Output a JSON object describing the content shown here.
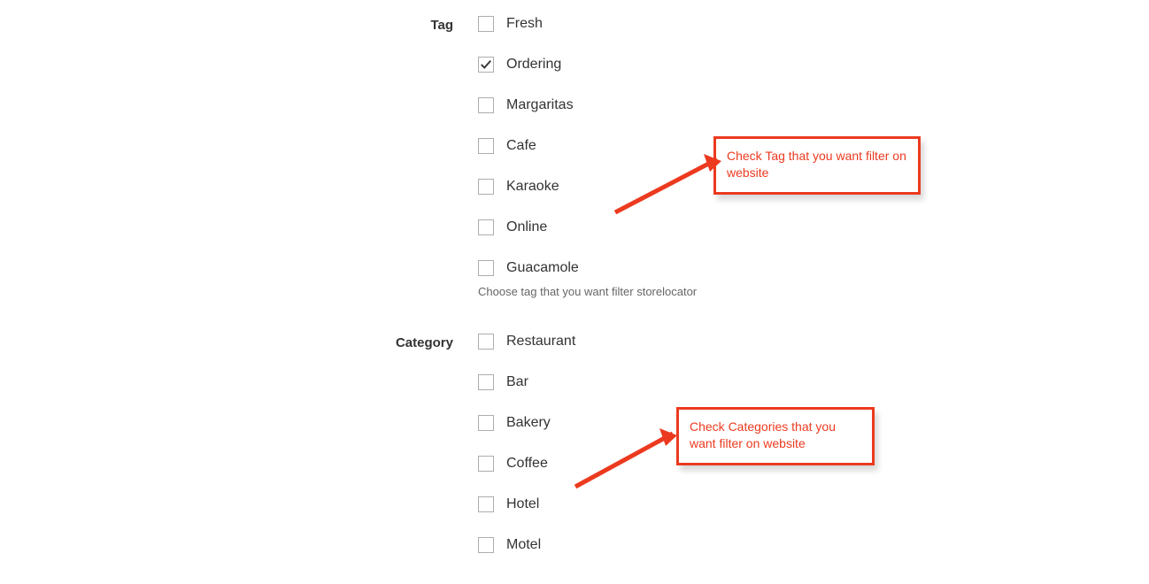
{
  "sections": {
    "tag": {
      "label": "Tag",
      "help": "Choose tag that you want filter storelocator",
      "items": [
        {
          "label": "Fresh",
          "checked": false
        },
        {
          "label": "Ordering",
          "checked": true
        },
        {
          "label": "Margaritas",
          "checked": false
        },
        {
          "label": "Cafe",
          "checked": false
        },
        {
          "label": "Karaoke",
          "checked": false
        },
        {
          "label": "Online",
          "checked": false
        },
        {
          "label": "Guacamole",
          "checked": false
        }
      ]
    },
    "category": {
      "label": "Category",
      "items": [
        {
          "label": "Restaurant",
          "checked": false
        },
        {
          "label": "Bar",
          "checked": false
        },
        {
          "label": "Bakery",
          "checked": false
        },
        {
          "label": "Coffee",
          "checked": false
        },
        {
          "label": "Hotel",
          "checked": false
        },
        {
          "label": "Motel",
          "checked": false
        }
      ]
    }
  },
  "annotations": {
    "tag_callout": "Check Tag that you want filter on website",
    "category_callout": "Check Categories that you want filter on website"
  }
}
